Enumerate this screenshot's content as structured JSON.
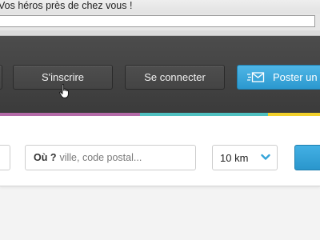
{
  "header": {
    "tagline": "Vos héros près de chez vous !",
    "signup_label": "S'inscrire",
    "login_label": "Se connecter",
    "post_label": "Poster un"
  },
  "search": {
    "where_label": "Où ?",
    "where_placeholder": "ville, code postal...",
    "radius_value": "10 km"
  },
  "icons": {
    "post": "envelope-icon",
    "radius": "chevron-down-icon",
    "cursor": "hand-pointer-icon"
  },
  "colors": {
    "header_bg": "#414141",
    "accent_blue": "#35a4d8",
    "stripe": [
      "#b46aa8",
      "#b46aa8",
      "#4fc0c0",
      "#f2d02a"
    ]
  }
}
